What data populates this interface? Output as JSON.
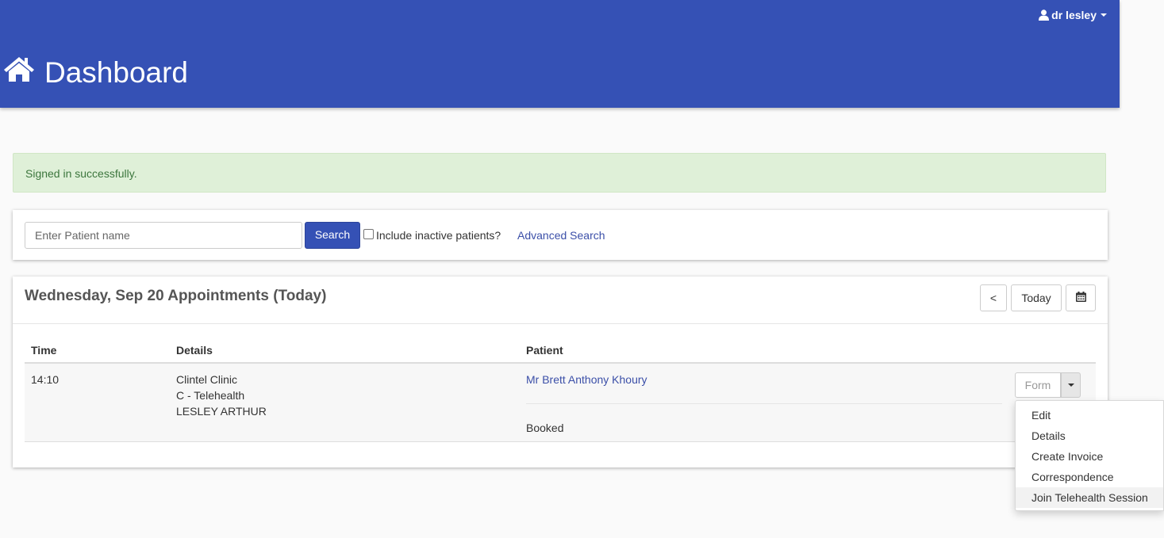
{
  "header": {
    "title": "Dashboard",
    "title_icon": "home-icon",
    "user_name": "dr lesley",
    "user_icon": "user-icon",
    "background_color": "#3551b5"
  },
  "alert": {
    "message": "Signed in successfully."
  },
  "search": {
    "placeholder": "Enter Patient name",
    "value": "",
    "button_label": "Search",
    "inactive_label": "Include inactive patients?",
    "inactive_checked": false,
    "advanced_label": "Advanced Search"
  },
  "appointments": {
    "title": "Wednesday, Sep 20 Appointments (Today)",
    "prev_label": "<",
    "today_label": "Today",
    "calendar_icon": "calendar-icon",
    "columns": [
      "Time",
      "Details",
      "Patient"
    ],
    "rows": [
      {
        "time": "14:10",
        "details": [
          "Clintel Clinic",
          "C - Telehealth",
          "LESLEY ARTHUR"
        ],
        "patient": "Mr Brett Anthony Khoury",
        "status": "Booked",
        "action_label": "Form"
      }
    ]
  },
  "action_menu": {
    "items": [
      "Edit",
      "Details",
      "Create Invoice",
      "Correspondence",
      "Join Telehealth Session"
    ],
    "highlighted": "Join Telehealth Session"
  }
}
